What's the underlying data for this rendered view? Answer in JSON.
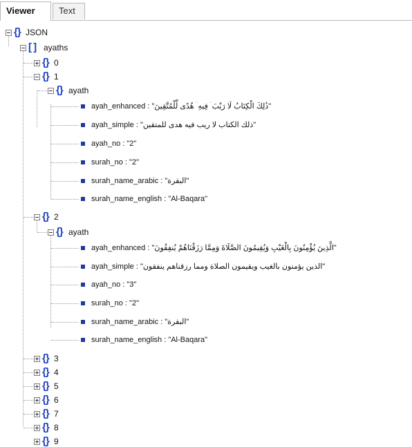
{
  "tabs": {
    "viewer": "Viewer",
    "text": "Text"
  },
  "tree": {
    "root": "JSON",
    "ayaths": "ayaths",
    "ayath_label": "ayath",
    "indices": [
      "0",
      "1",
      "2",
      "3",
      "4",
      "5",
      "6",
      "7",
      "8",
      "9"
    ],
    "item1": [
      {
        "key": "ayah_enhanced",
        "value": "\"ذَٰلِكَ الْكِتَابُ لَا رَيْبَ ۛ فِيهِ ۛ هُدًى لِّلْمُتَّقِينَ\""
      },
      {
        "key": "ayah_simple",
        "value": "\"ذلك الكتاب لا ريب فيه هدى للمتقين\""
      },
      {
        "key": "ayah_no",
        "value": "\"2\""
      },
      {
        "key": "surah_no",
        "value": "\"2\""
      },
      {
        "key": "surah_name_arabic",
        "value": "\"البقرة\""
      },
      {
        "key": "surah_name_english",
        "value": "\"Al-Baqara\""
      }
    ],
    "item2": [
      {
        "key": "ayah_enhanced",
        "value": "\"الَّذِينَ يُؤْمِنُونَ بِالْغَيْبِ وَيُقِيمُونَ الصَّلَاةَ وَمِمَّا رَزَقْنَاهُمْ يُنفِقُونَ\""
      },
      {
        "key": "ayah_simple",
        "value": "\"الذين يؤمنون بالغيب ويقيمون الصلاة ومما رزقناهم ينفقون\""
      },
      {
        "key": "ayah_no",
        "value": "\"3\""
      },
      {
        "key": "surah_no",
        "value": "\"2\""
      },
      {
        "key": "surah_name_arabic",
        "value": "\"البقرة\""
      },
      {
        "key": "surah_name_english",
        "value": "\"Al-Baqara\""
      }
    ],
    "separator": " : "
  }
}
